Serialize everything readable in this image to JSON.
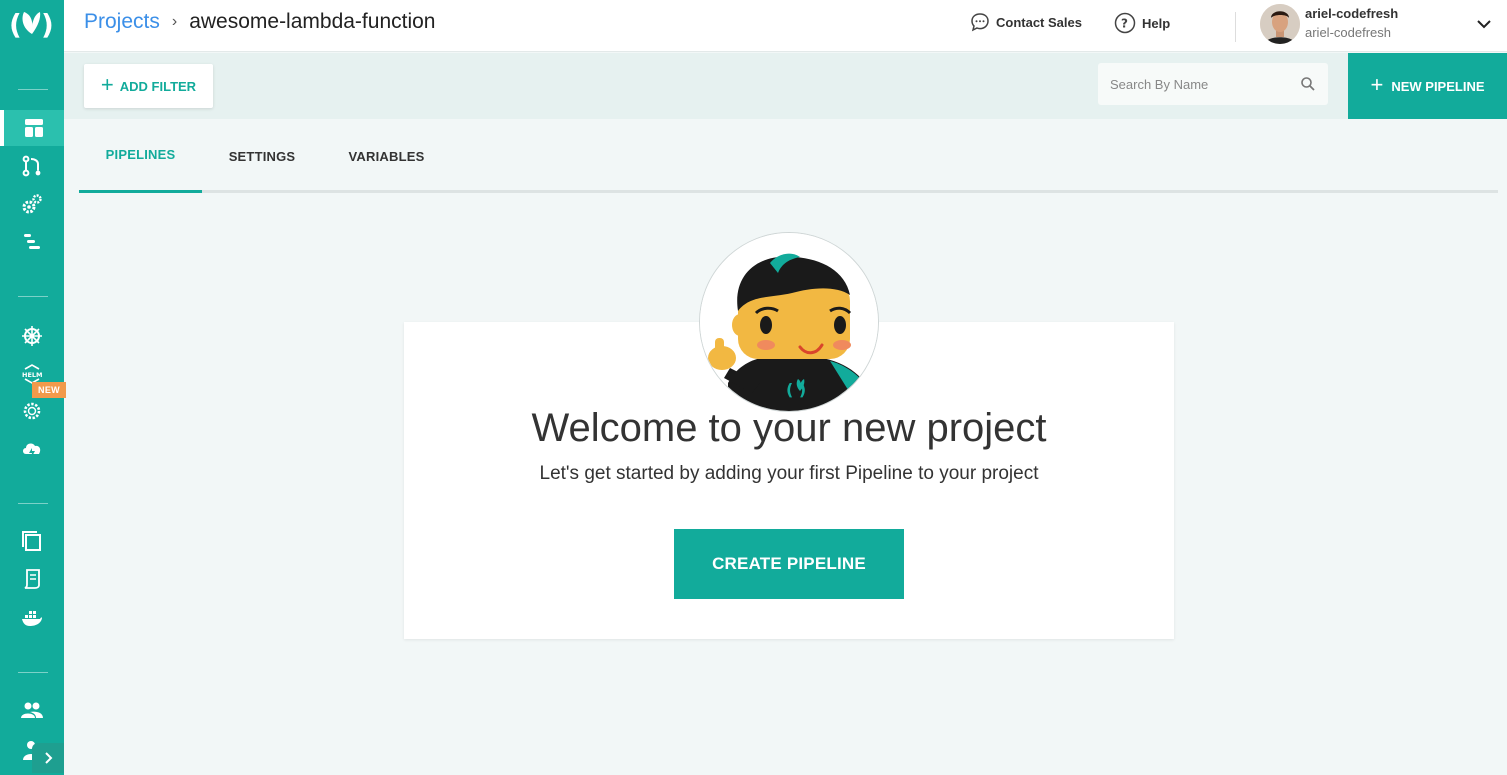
{
  "sidebar": {
    "logo": "codefresh-logo",
    "items": [
      {
        "icon": "dashboard-icon",
        "active": true
      },
      {
        "icon": "builds-icon"
      },
      {
        "icon": "settings-gears-icon"
      },
      {
        "icon": "pipelines-icon"
      },
      {
        "icon": "kubernetes-icon"
      },
      {
        "icon": "helm-icon"
      },
      {
        "icon": "helm-releases-icon"
      },
      {
        "icon": "cloud-deploy-icon"
      },
      {
        "icon": "artifacts-icon"
      },
      {
        "icon": "test-reports-icon"
      },
      {
        "icon": "docker-registry-icon"
      },
      {
        "icon": "team-icon"
      },
      {
        "icon": "account-icon"
      }
    ],
    "new_badge": "NEW"
  },
  "header": {
    "breadcrumb_root": "Projects",
    "breadcrumb_current": "awesome-lambda-function",
    "contact_label": "Contact Sales",
    "help_label": "Help",
    "user_name": "ariel-codefresh",
    "user_account": "ariel-codefresh"
  },
  "filterbar": {
    "add_filter_label": "ADD FILTER",
    "search_placeholder": "Search By Name",
    "new_pipeline_label": "NEW PIPELINE"
  },
  "tabs": [
    {
      "label": "PIPELINES",
      "active": true
    },
    {
      "label": "SETTINGS"
    },
    {
      "label": "VARIABLES"
    }
  ],
  "welcome": {
    "title": "Welcome to your new project",
    "subtitle": "Let's get started by adding your first Pipeline to your project",
    "create_label": "CREATE PIPELINE"
  },
  "colors": {
    "brand": "#12ab9b",
    "link": "#3b8fe8",
    "badge": "#f29a4b"
  }
}
